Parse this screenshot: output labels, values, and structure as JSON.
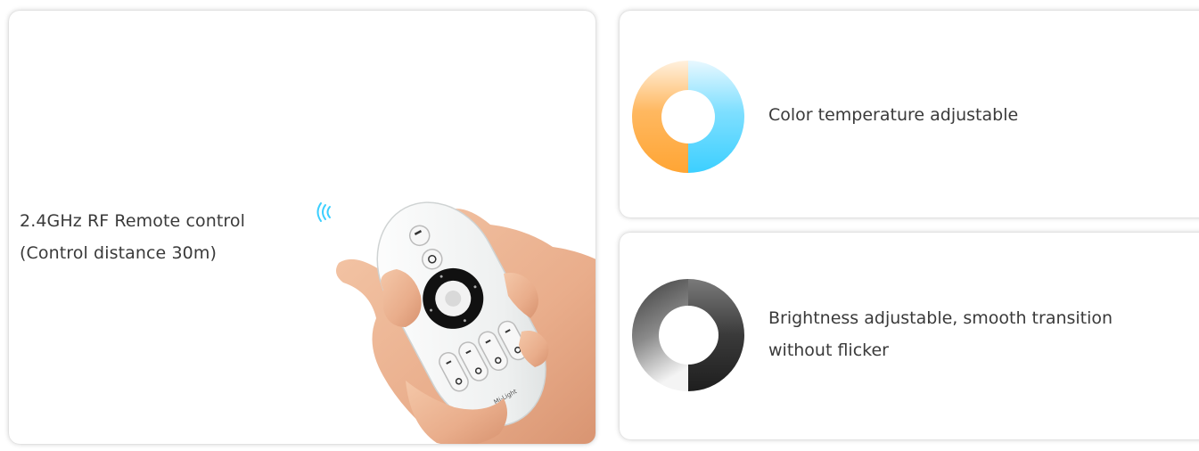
{
  "remote_card": {
    "line1": "2.4GHz RF Remote control",
    "line2": "(Control distance 30m)",
    "signal_icon": "wireless-signal-icon",
    "image": "hand-holding-remote-image",
    "brand_text": "Mi-Light"
  },
  "features": [
    {
      "icon": "color-temperature-ring-icon",
      "text": "Color temperature adjustable",
      "colors": {
        "warm": "#FFA534",
        "cool": "#3CCFFF"
      }
    },
    {
      "icon": "brightness-ring-icon",
      "text_line1": "Brightness adjustable, smooth transition",
      "text_line2": "without flicker",
      "colors": {
        "dark": "#2b2b2b",
        "light": "#f2f2f2"
      }
    }
  ],
  "accent": "#3CCFFF"
}
